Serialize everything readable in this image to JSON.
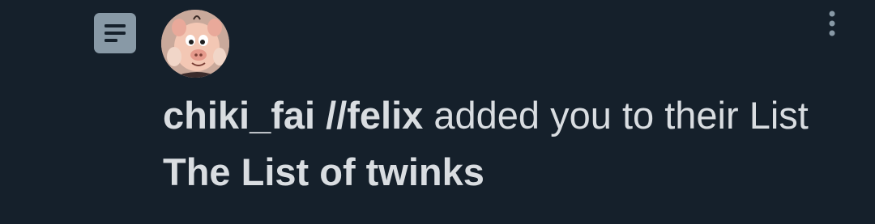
{
  "notification": {
    "icons": {
      "type_icon": "list-icon",
      "avatar": "pig-cartoon-avatar",
      "menu": "more-vertical-icon"
    },
    "actor_name": "chiki_fai //felix",
    "action_text": " added you to their List ",
    "list_name": "The List of twinks"
  },
  "colors": {
    "background": "#15202B",
    "text": "#D9DDE1",
    "icon_gray": "#8899A6"
  }
}
